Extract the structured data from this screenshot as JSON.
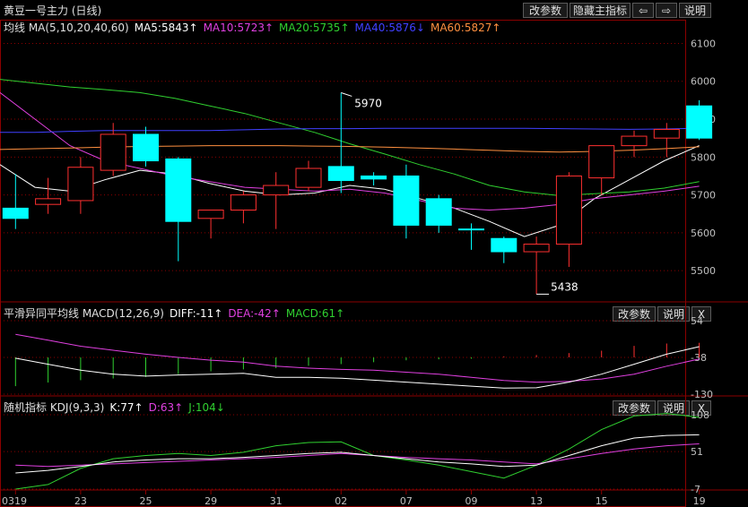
{
  "header": {
    "title": "黄豆一号主力 (日线)",
    "buttons": {
      "params": "改参数",
      "hide": "隐藏主指标",
      "prev": "⇦",
      "next": "⇨",
      "help": "说明"
    }
  },
  "main_panel": {
    "legend": [
      {
        "text": "均线 MA(5,10,20,40,60)",
        "color": "#e0e0e0"
      },
      {
        "text": "MA5:5843↑",
        "color": "#ffffff"
      },
      {
        "text": "MA10:5723↑",
        "color": "#e040e0"
      },
      {
        "text": "MA20:5735↑",
        "color": "#30d030"
      },
      {
        "text": "MA40:5876↓",
        "color": "#4040ff"
      },
      {
        "text": "MA60:5827↑",
        "color": "#ff9040"
      }
    ],
    "y_ticks": [
      "6100",
      "6000",
      "5900",
      "5800",
      "5700",
      "5600",
      "5500"
    ],
    "annotations": {
      "high": "5970",
      "low": "5438"
    }
  },
  "macd_panel": {
    "legend": [
      {
        "text": "平滑异同平均线 MACD(12,26,9)",
        "color": "#e0e0e0"
      },
      {
        "text": "DIFF:-11↑",
        "color": "#ffffff"
      },
      {
        "text": "DEA:-42↑",
        "color": "#e040e0"
      },
      {
        "text": "MACD:61↑",
        "color": "#30d030"
      }
    ],
    "buttons": {
      "params": "改参数",
      "help": "说明",
      "close": "X"
    },
    "y_ticks": [
      "54",
      "-38",
      "-130"
    ]
  },
  "kdj_panel": {
    "legend": [
      {
        "text": "随机指标 KDJ(9,3,3)",
        "color": "#e0e0e0"
      },
      {
        "text": "K:77↑",
        "color": "#ffffff"
      },
      {
        "text": "D:63↑",
        "color": "#e040e0"
      },
      {
        "text": "J:104↓",
        "color": "#30d030"
      }
    ],
    "buttons": {
      "params": "改参数",
      "help": "说明",
      "close": "X"
    },
    "y_ticks": [
      "108",
      "51",
      "-7"
    ]
  },
  "x_axis": {
    "labels": [
      "0319",
      "23",
      "25",
      "29",
      "31",
      "02",
      "07",
      "09",
      "13",
      "15",
      "19"
    ]
  },
  "colors": {
    "up": "#ff3030",
    "down": "#00ffff",
    "grid": "#8b0000",
    "text": "#c0c0c0"
  },
  "chart_data": {
    "type": "candlestick",
    "series": [
      {
        "name": "MA5",
        "values": [
          5780,
          5720,
          5710,
          5740,
          5765,
          5755,
          5730,
          5710,
          5700,
          5705,
          5725,
          5715,
          5690,
          5665,
          5630,
          5590,
          5620,
          5690,
          5740,
          5790,
          5830
        ]
      },
      {
        "name": "MA10",
        "values": [
          5970,
          5900,
          5830,
          5790,
          5770,
          5750,
          5735,
          5720,
          5715,
          5710,
          5715,
          5705,
          5685,
          5665,
          5660,
          5665,
          5675,
          5690,
          5700,
          5710,
          5723
        ]
      },
      {
        "name": "MA20",
        "values": [
          6005,
          5995,
          5985,
          5978,
          5970,
          5955,
          5935,
          5915,
          5890,
          5865,
          5835,
          5808,
          5780,
          5755,
          5725,
          5708,
          5698,
          5703,
          5708,
          5718,
          5735
        ]
      },
      {
        "name": "MA40",
        "values": [
          5865,
          5865,
          5868,
          5870,
          5870,
          5870,
          5870,
          5872,
          5874,
          5875,
          5875,
          5876,
          5876,
          5876,
          5876,
          5876,
          5875,
          5874,
          5873,
          5874,
          5876
        ]
      },
      {
        "name": "MA60",
        "values": [
          5820,
          5822,
          5824,
          5826,
          5828,
          5829,
          5830,
          5830,
          5830,
          5829,
          5828,
          5826,
          5824,
          5821,
          5818,
          5815,
          5813,
          5815,
          5818,
          5822,
          5827
        ]
      }
    ],
    "candles": [
      {
        "o": 5665,
        "h": 5755,
        "l": 5610,
        "c": 5638
      },
      {
        "o": 5675,
        "h": 5745,
        "l": 5650,
        "c": 5690
      },
      {
        "o": 5685,
        "h": 5800,
        "l": 5650,
        "c": 5773
      },
      {
        "o": 5765,
        "h": 5890,
        "l": 5750,
        "c": 5860
      },
      {
        "o": 5860,
        "h": 5880,
        "l": 5775,
        "c": 5790
      },
      {
        "o": 5795,
        "h": 5800,
        "l": 5525,
        "c": 5630
      },
      {
        "o": 5638,
        "h": 5660,
        "l": 5585,
        "c": 5660
      },
      {
        "o": 5660,
        "h": 5710,
        "l": 5625,
        "c": 5700
      },
      {
        "o": 5700,
        "h": 5760,
        "l": 5610,
        "c": 5725
      },
      {
        "o": 5720,
        "h": 5790,
        "l": 5710,
        "c": 5770
      },
      {
        "o": 5775,
        "h": 5970,
        "l": 5705,
        "c": 5738
      },
      {
        "o": 5750,
        "h": 5760,
        "l": 5725,
        "c": 5742
      },
      {
        "o": 5750,
        "h": 5780,
        "l": 5585,
        "c": 5620
      },
      {
        "o": 5690,
        "h": 5700,
        "l": 5600,
        "c": 5620
      },
      {
        "o": 5610,
        "h": 5625,
        "l": 5555,
        "c": 5608
      },
      {
        "o": 5585,
        "h": 5590,
        "l": 5520,
        "c": 5550
      },
      {
        "o": 5550,
        "h": 5590,
        "l": 5438,
        "c": 5570
      },
      {
        "o": 5570,
        "h": 5760,
        "l": 5510,
        "c": 5750
      },
      {
        "o": 5745,
        "h": 5830,
        "l": 5700,
        "c": 5830
      },
      {
        "o": 5830,
        "h": 5870,
        "l": 5800,
        "c": 5855
      },
      {
        "o": 5850,
        "h": 5890,
        "l": 5800,
        "c": 5873
      },
      {
        "o": 5935,
        "h": 5950,
        "l": 5845,
        "c": 5850
      }
    ],
    "macd": {
      "diff": [
        -40,
        -55,
        -70,
        -80,
        -85,
        -82,
        -80,
        -78,
        -88,
        -88,
        -90,
        -95,
        -100,
        -105,
        -110,
        -115,
        -114,
        -100,
        -80,
        -55,
        -30,
        -11
      ],
      "dea": [
        20,
        5,
        -10,
        -20,
        -30,
        -38,
        -45,
        -50,
        -60,
        -65,
        -68,
        -70,
        -75,
        -80,
        -88,
        -96,
        -100,
        -98,
        -92,
        -80,
        -60,
        -42
      ],
      "bar": [
        -120,
        -105,
        -95,
        -88,
        -82,
        -70,
        -58,
        -50,
        -45,
        -35,
        -28,
        -20,
        -12,
        -8,
        -5,
        4,
        10,
        18,
        28,
        48,
        58,
        61
      ]
    },
    "kdj": {
      "k": [
        18,
        22,
        28,
        35,
        38,
        40,
        40,
        42,
        45,
        48,
        50,
        45,
        40,
        35,
        32,
        28,
        30,
        45,
        60,
        72,
        76,
        77
      ],
      "d": [
        30,
        28,
        30,
        32,
        34,
        36,
        38,
        40,
        42,
        45,
        48,
        45,
        42,
        40,
        38,
        35,
        32,
        40,
        48,
        55,
        60,
        63
      ],
      "j": [
        -7,
        0,
        25,
        40,
        45,
        48,
        45,
        50,
        60,
        65,
        66,
        45,
        38,
        30,
        20,
        10,
        30,
        55,
        85,
        106,
        110,
        104
      ]
    }
  }
}
